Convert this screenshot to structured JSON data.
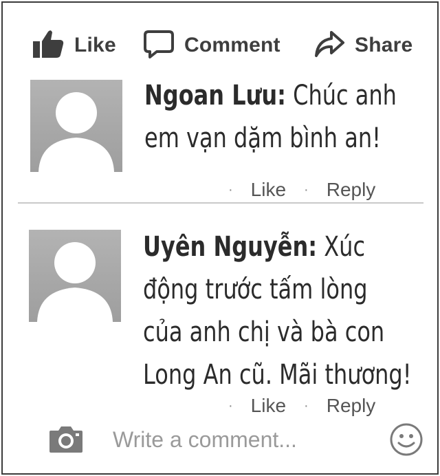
{
  "actions_bar": {
    "like_label": "Like",
    "comment_label": "Comment",
    "share_label": "Share"
  },
  "comments": [
    {
      "author": "Ngoan Lưu:",
      "lines": [
        " Chúc anh",
        "em vạn dặm bình an!"
      ],
      "like_label": "Like",
      "reply_label": "Reply"
    },
    {
      "author": "Uyên Nguyễn:",
      "lines": [
        " Xúc",
        "động trước tấm lòng",
        "của anh chị và bà con",
        "Long An cũ. Mãi thương!"
      ],
      "like_label": "Like",
      "reply_label": "Reply"
    }
  ],
  "composer": {
    "placeholder": "Write a comment..."
  },
  "icons": {
    "like": "thumbs-up-icon",
    "comment": "speech-bubble-icon",
    "share": "share-arrow-icon",
    "camera": "camera-icon",
    "emoji": "smiley-icon",
    "avatar": "default-avatar-icon"
  },
  "colors": {
    "text": "#2b2b2b",
    "icon": "#3e3e3e",
    "placeholder": "#9a9a9a",
    "avatar_bg": "#a8a8a8"
  }
}
